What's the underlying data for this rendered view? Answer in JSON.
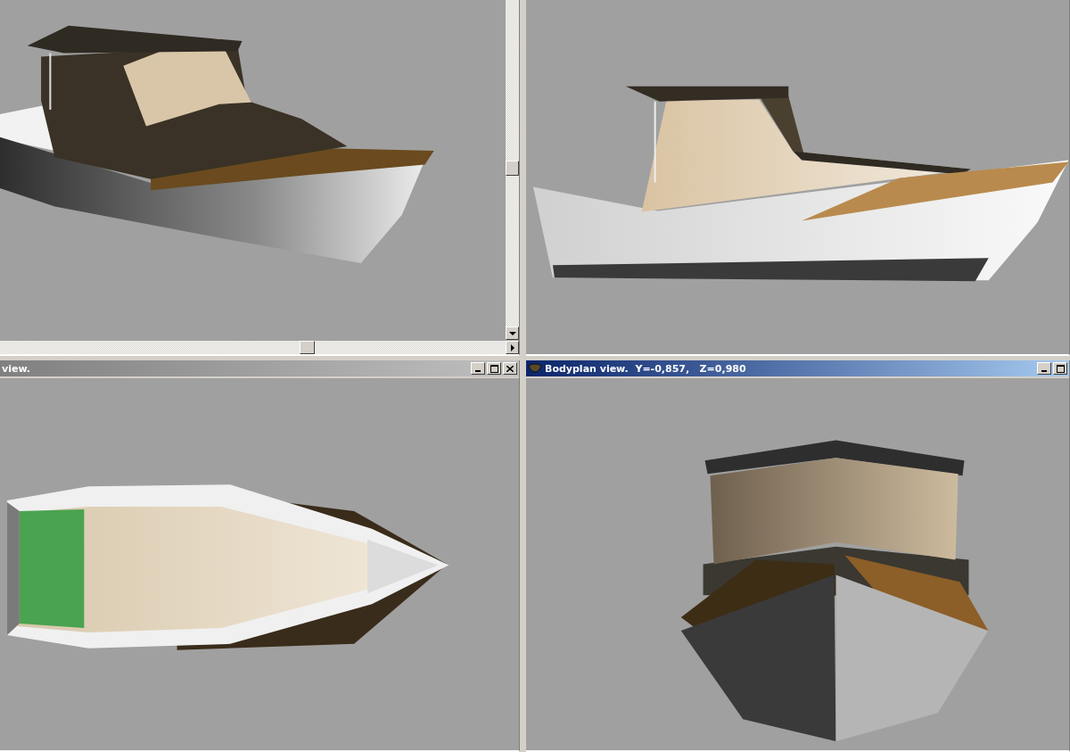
{
  "windows": [
    {
      "kind": "perspective",
      "scrollbars": true
    },
    {
      "kind": "profile",
      "scrollbars": false
    },
    {
      "kind": "plan",
      "scrollbars": false,
      "title": "view.",
      "active": false,
      "buttons": [
        {
          "kind": "minimize"
        },
        {
          "kind": "maximize"
        },
        {
          "kind": "close"
        }
      ]
    },
    {
      "kind": "bodyplan",
      "scrollbars": false,
      "title": "Bodyplan view.  Y=-0,857,   Z=0,980",
      "active": true,
      "buttons": [
        {
          "kind": "minimize"
        },
        {
          "kind": "maximize"
        }
      ]
    }
  ]
}
